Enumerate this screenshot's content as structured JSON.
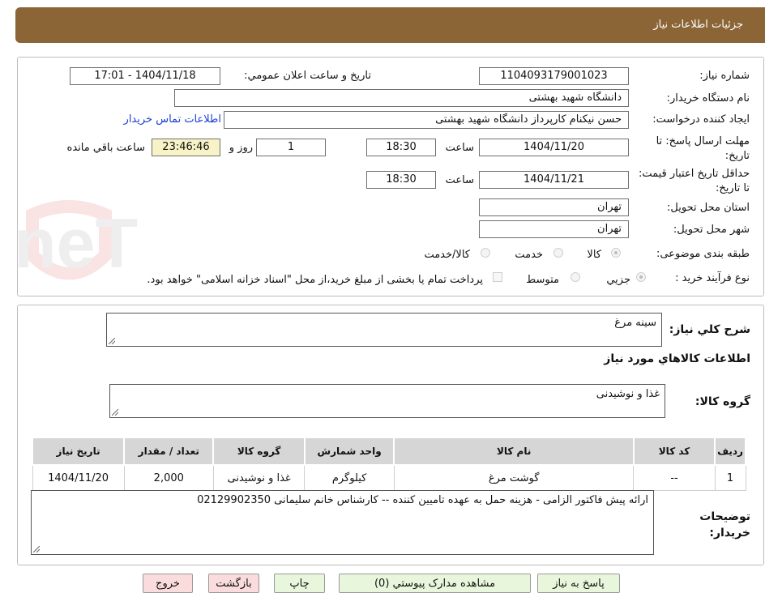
{
  "header": {
    "title": "جزئیات اطلاعات نیاز"
  },
  "form": {
    "need_number_label": "شماره نیاز:",
    "need_number": "1104093179001023",
    "announce_label": "تاریخ و ساعت اعلان عمومي:",
    "announce_value": "1404/11/18 - 17:01",
    "buyer_org_label": "نام دستگاه خريدار:",
    "buyer_org": "دانشگاه شهید بهشتی",
    "requester_label": "ايجاد کننده درخواست:",
    "requester": "حسن نیکنام کارپرداز دانشگاه شهید بهشتی",
    "contact_link": "اطلاعات تماس خريدار",
    "deadline_label": "مهلت ارسال پاسخ: تا تاریخ:",
    "deadline_date": "1404/11/20",
    "time_label": "ساعت",
    "deadline_time": "18:30",
    "days_value": "1",
    "days_label": "روز و",
    "remaining_time": "23:46:46",
    "remaining_label": "ساعت باقي مانده",
    "validity_label": "حداقل تاریخ اعتبار قیمت: تا تاریخ:",
    "validity_date": "1404/11/21",
    "validity_time": "18:30",
    "province_label": "استان محل تحویل:",
    "province": "تهران",
    "city_label": "شهر محل تحویل:",
    "city": "تهران",
    "category_label": "طبقه بندی موضوعی:",
    "category_options": [
      "کالا",
      "خدمت",
      "کالا/خدمت"
    ],
    "process_label": "نوع فرآیند خرید :",
    "process_options": [
      "جزیي",
      "متوسط"
    ],
    "process_note": "پرداخت تمام یا بخشی از مبلغ خرید،از محل \"اسناد خزانه اسلامی\" خواهد بود."
  },
  "details": {
    "summary_label": "شرح کلي نياز:",
    "summary_value": "سینه مرغ",
    "goods_info_title": "اطلاعات کالاهاي مورد نياز",
    "goods_group_label": "گروه کالا:",
    "goods_group_value": "غذا و نوشیدنی",
    "table": {
      "headers": [
        "رديف",
        "کد کالا",
        "نام کالا",
        "واحد شمارش",
        "گروه کالا",
        "تعداد / مقدار",
        "تاریخ نیاز"
      ],
      "rows": [
        [
          "1",
          "--",
          "گوشت مرغ",
          "کیلوگرم",
          "غذا و نوشیدنی",
          "2,000",
          "1404/11/20"
        ]
      ]
    },
    "buyer_notes_label": "توضيحات خريدار:",
    "buyer_notes_value": "ارائه پیش فاکتور الزامی - هزینه حمل به عهده تامیین کننده -- کارشناس خانم سلیمانی 02129902350"
  },
  "buttons": {
    "reply": "پاسخ به نياز",
    "attachments": "مشاهده مدارک پيوستي (0)",
    "print": "چاپ",
    "back": "بازگشت",
    "exit": "خروج"
  },
  "watermark": {
    "brand": "AriaTender.neT"
  },
  "colors": {
    "header_bg": "#8b6536",
    "link": "#1a3fd6",
    "remaining_bg": "#f7f3c6"
  }
}
